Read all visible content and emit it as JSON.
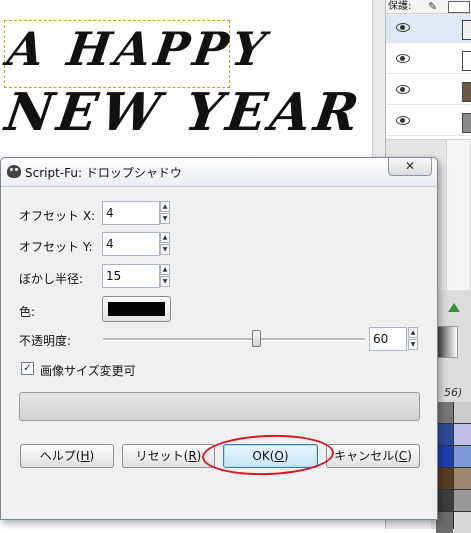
{
  "canvas": {
    "art_lines": [
      "A HAPPY",
      "NEW YEAR"
    ]
  },
  "dock": {
    "top_label": "保護:",
    "layer_count": 4,
    "partial_text": "56)"
  },
  "dialog": {
    "title": "Script-Fu: ドロップシャドウ",
    "close_glyph": "✕",
    "fields": {
      "offset_x": {
        "label": "オフセット X:",
        "value": "4"
      },
      "offset_y": {
        "label": "オフセット Y:",
        "value": "4"
      },
      "blur_radius": {
        "label": "ぼかし半径:",
        "value": "15"
      },
      "color": {
        "label": "色:",
        "value": "#000000"
      },
      "opacity": {
        "label": "不透明度:",
        "value": "60",
        "slider_fraction": 0.6
      }
    },
    "resize_checkbox": {
      "label": "画像サイズ変更可",
      "checked": true,
      "glyph": "✓"
    },
    "buttons": {
      "help": {
        "text": "ヘルプ(",
        "mnemonic": "H",
        "close": ")"
      },
      "reset": {
        "text": "リセット(",
        "mnemonic": "R",
        "close": ")"
      },
      "ok": {
        "text": "OK(",
        "mnemonic": "O",
        "close": ")"
      },
      "cancel": {
        "text": "キャンセル(",
        "mnemonic": "C",
        "close": ")"
      }
    }
  },
  "colors": {
    "annotation_ring": "#d6141a",
    "selection_dash": "#c9a21a",
    "shadow_color": "#000000"
  },
  "icons": [
    "gimp-icon",
    "close-icon",
    "eye-icon",
    "brush-icon",
    "spin-up-icon",
    "spin-down-icon",
    "checkmark-icon",
    "green-arrow-icon"
  ]
}
